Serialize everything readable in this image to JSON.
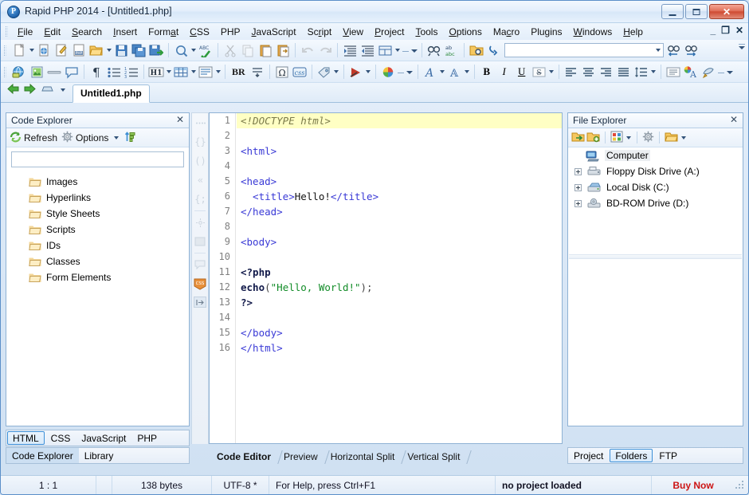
{
  "window": {
    "title": "Rapid PHP 2014 - [Untitled1.php]",
    "app_icon": "rapid-php-logo-icon",
    "minimize": "minimize-icon",
    "maximize": "maximize-icon",
    "close": "close-icon"
  },
  "menubar": {
    "items": [
      {
        "label": "File",
        "accel": "F"
      },
      {
        "label": "Edit",
        "accel": "E"
      },
      {
        "label": "Search",
        "accel": "S"
      },
      {
        "label": "Insert",
        "accel": "I"
      },
      {
        "label": "Format",
        "accel": "a"
      },
      {
        "label": "CSS",
        "accel": "C"
      },
      {
        "label": "PHP",
        "accel": ""
      },
      {
        "label": "JavaScript",
        "accel": "J"
      },
      {
        "label": "Script",
        "accel": "r"
      },
      {
        "label": "View",
        "accel": "V"
      },
      {
        "label": "Project",
        "accel": "P"
      },
      {
        "label": "Tools",
        "accel": "T"
      },
      {
        "label": "Options",
        "accel": "O"
      },
      {
        "label": "Macro",
        "accel": "c"
      },
      {
        "label": "Plugins",
        "accel": ""
      },
      {
        "label": "Windows",
        "accel": "W"
      },
      {
        "label": "Help",
        "accel": "H"
      }
    ],
    "mdi": {
      "minimize": "_",
      "restore": "❐",
      "close": "✕"
    }
  },
  "toolbar_row1": {
    "search_value": "",
    "search_placeholder": "",
    "icons": [
      "new-file-icon",
      "new-file-dropdown",
      "new-html-file-icon",
      "new-css-file-icon",
      "new-php-file-icon",
      "open-file-icon",
      "open-file-dropdown",
      "save-icon",
      "save-all-icon",
      "save-as-icon",
      "preview-icon",
      "preview-dropdown",
      "spellcheck-icon",
      "cut-icon",
      "copy-icon",
      "paste-icon",
      "paste-special-icon",
      "undo-icon",
      "redo-icon",
      "indent-icon",
      "outdent-icon",
      "split-view-icon",
      "split-view-dropdown",
      "find-icon",
      "replace-icon",
      "find-in-files-icon",
      "goto-line-icon",
      "find-previous-icon",
      "find-next-icon"
    ]
  },
  "toolbar_row2": {
    "br_label": "BR",
    "icons": [
      "insert-link-icon",
      "insert-image-icon",
      "horizontal-rule-icon",
      "insert-comment-icon",
      "paragraph-icon",
      "unordered-list-icon",
      "ordered-list-icon",
      "heading-icon",
      "heading-dropdown",
      "table-icon",
      "table-dropdown",
      "form-icon",
      "form-dropdown",
      "line-break-icon",
      "special-char-icon",
      "css-style-icon",
      "tag-icon",
      "tag-dropdown",
      "run-icon",
      "run-dropdown",
      "color-picker-icon",
      "font-icon",
      "font-dropdown",
      "font-style-icon",
      "font-style-dropdown",
      "bold-icon",
      "italic-icon",
      "underline-icon",
      "strikethrough-icon",
      "strikethrough-dropdown",
      "align-left-icon",
      "align-center-icon",
      "align-right-icon",
      "align-justify-icon",
      "line-spacing-icon",
      "line-spacing-dropdown",
      "blockquote-icon",
      "text-color-icon",
      "format-painter-icon"
    ],
    "format_labels": {
      "bold": "B",
      "italic": "I",
      "underline": "U",
      "strike": "S"
    }
  },
  "doc_tabs": {
    "back_icon": "back-arrow-icon",
    "forward_icon": "forward-arrow-icon",
    "window_list_icon": "window-list-icon",
    "tabs": [
      {
        "label": "Untitled1.php",
        "active": true
      }
    ]
  },
  "code_explorer": {
    "title": "Code Explorer",
    "close_icon": "close-icon",
    "toolbar": {
      "refresh_label": "Refresh",
      "refresh_icon": "refresh-icon",
      "options_label": "Options",
      "options_icon": "gear-icon",
      "sort_icon": "sort-icon"
    },
    "filter_value": "",
    "filter_placeholder": "",
    "nodes": [
      {
        "label": "Images",
        "icon": "folder-icon"
      },
      {
        "label": "Hyperlinks",
        "icon": "folder-icon"
      },
      {
        "label": "Style Sheets",
        "icon": "folder-icon"
      },
      {
        "label": "Scripts",
        "icon": "folder-icon"
      },
      {
        "label": "IDs",
        "icon": "folder-icon"
      },
      {
        "label": "Classes",
        "icon": "folder-icon"
      },
      {
        "label": "Form Elements",
        "icon": "folder-icon"
      }
    ],
    "language_tabs": [
      {
        "label": "HTML",
        "selected": true
      },
      {
        "label": "CSS",
        "selected": false
      },
      {
        "label": "JavaScript",
        "selected": false
      },
      {
        "label": "PHP",
        "selected": false
      }
    ],
    "panel_tabs": [
      {
        "label": "Code Explorer",
        "selected": true
      },
      {
        "label": "Library",
        "selected": false
      }
    ]
  },
  "editor_strip": {
    "icons": [
      "bookmark-dots-icon",
      "code-fold-icon-1",
      "code-fold-icon-2",
      "code-fold-icon-3",
      "code-fold-icon-4",
      "snippet-icon",
      "clipboard-icon",
      "comment-icon",
      "css-badge-icon",
      "expand-panel-icon"
    ]
  },
  "editor": {
    "filename": "Untitled1.php",
    "current_line": 1,
    "lines": [
      {
        "n": 1,
        "cur": true,
        "tokens": [
          {
            "t": "doctype",
            "v": "<!DOCTYPE html>"
          }
        ]
      },
      {
        "n": 2,
        "cur": false,
        "tokens": []
      },
      {
        "n": 3,
        "cur": false,
        "tokens": [
          {
            "t": "tag",
            "v": "<html>"
          }
        ]
      },
      {
        "n": 4,
        "cur": false,
        "tokens": []
      },
      {
        "n": 5,
        "cur": false,
        "tokens": [
          {
            "t": "tag",
            "v": "<head>"
          }
        ]
      },
      {
        "n": 6,
        "cur": false,
        "tokens": [
          {
            "t": "tag",
            "v": "  <title>"
          },
          {
            "t": "txt",
            "v": "Hello!"
          },
          {
            "t": "tag",
            "v": "</title>"
          }
        ]
      },
      {
        "n": 7,
        "cur": false,
        "tokens": [
          {
            "t": "tag",
            "v": "</head>"
          }
        ]
      },
      {
        "n": 8,
        "cur": false,
        "tokens": []
      },
      {
        "n": 9,
        "cur": false,
        "tokens": [
          {
            "t": "tag",
            "v": "<body>"
          }
        ]
      },
      {
        "n": 10,
        "cur": false,
        "tokens": []
      },
      {
        "n": 11,
        "cur": false,
        "tokens": [
          {
            "t": "php",
            "v": "<?php"
          }
        ]
      },
      {
        "n": 12,
        "cur": false,
        "tokens": [
          {
            "t": "php",
            "v": "echo"
          },
          {
            "t": "punct",
            "v": "("
          },
          {
            "t": "str",
            "v": "\"Hello, World!\""
          },
          {
            "t": "punct",
            "v": ");"
          }
        ]
      },
      {
        "n": 13,
        "cur": false,
        "tokens": [
          {
            "t": "php",
            "v": "?>"
          }
        ]
      },
      {
        "n": 14,
        "cur": false,
        "tokens": []
      },
      {
        "n": 15,
        "cur": false,
        "tokens": [
          {
            "t": "tag",
            "v": "</body>"
          }
        ]
      },
      {
        "n": 16,
        "cur": false,
        "tokens": [
          {
            "t": "tag",
            "v": "</html>"
          }
        ]
      }
    ],
    "view_tabs": [
      {
        "label": "Code Editor",
        "active": true
      },
      {
        "label": "Preview",
        "active": false
      },
      {
        "label": "Horizontal Split",
        "active": false
      },
      {
        "label": "Vertical Split",
        "active": false
      }
    ]
  },
  "file_explorer": {
    "title": "File Explorer",
    "close_icon": "close-icon",
    "toolbar": {
      "open_folder_icon": "open-folder-icon",
      "new-folder_icon": "new-folder-icon",
      "view-mode_icon": "view-mode-icon",
      "view-mode_dropdown": "chevron-down-icon",
      "settings_icon": "gear-icon",
      "folder_icon": "folder-icon",
      "folder_dropdown": "chevron-down-icon"
    },
    "tree": [
      {
        "label": "Computer",
        "icon": "computer-icon",
        "indent": 0,
        "expandable": false,
        "selected": true
      },
      {
        "label": "Floppy Disk Drive (A:)",
        "icon": "floppy-drive-icon",
        "indent": 1,
        "expandable": true,
        "selected": false
      },
      {
        "label": "Local Disk (C:)",
        "icon": "hard-drive-icon",
        "indent": 1,
        "expandable": true,
        "selected": false
      },
      {
        "label": "BD-ROM Drive (D:)",
        "icon": "optical-drive-icon",
        "indent": 1,
        "expandable": true,
        "selected": false
      }
    ],
    "panel_tabs": [
      {
        "label": "Project",
        "selected": false
      },
      {
        "label": "Folders",
        "selected": true
      },
      {
        "label": "FTP",
        "selected": false
      }
    ]
  },
  "statusbar": {
    "cursor": "1 : 1",
    "selection": "",
    "size": "138 bytes",
    "encoding": "UTF-8 *",
    "hint": "For Help, press Ctrl+F1",
    "project": "no project loaded",
    "buy_now": "Buy Now"
  },
  "colors": {
    "accent": "#3d90d8",
    "tag": "#3a3ad6",
    "string": "#128c28",
    "php_keyword": "#121a4a",
    "doctype": "#7a7a4a",
    "current_line": "#ffffc4",
    "buy_now": "#cc1414",
    "chrome": "#d4e4f5"
  }
}
